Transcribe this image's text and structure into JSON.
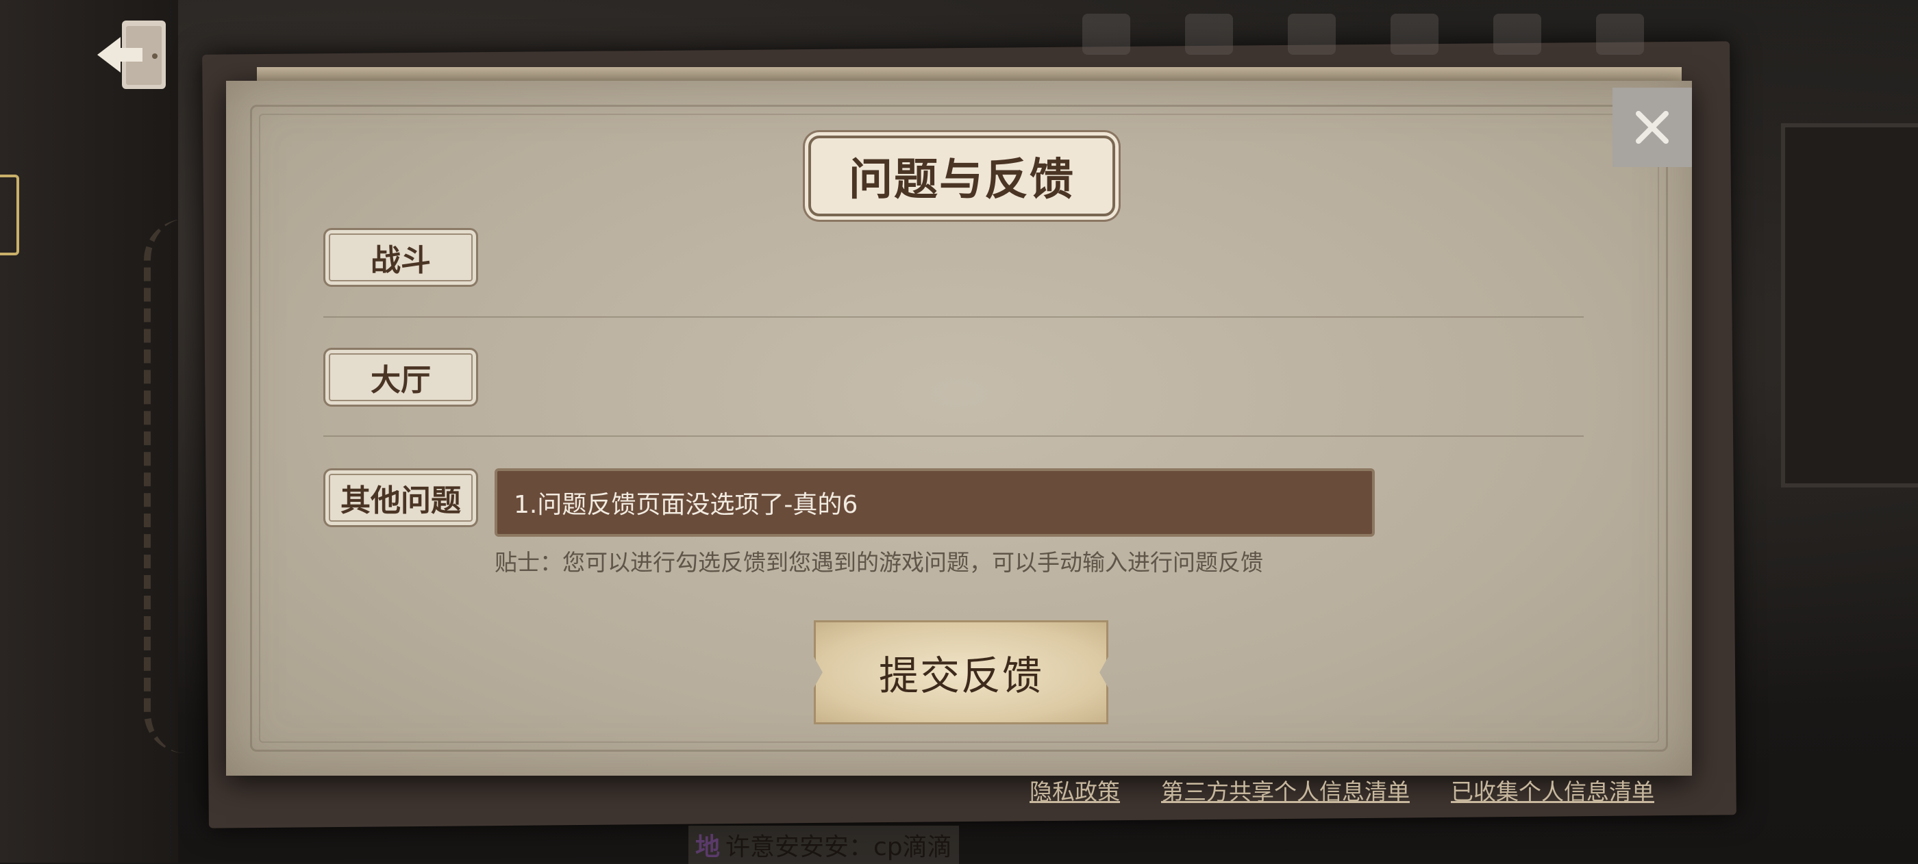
{
  "panel": {
    "title": "问题与反馈",
    "categories": [
      {
        "label": "战斗"
      },
      {
        "label": "大厅"
      },
      {
        "label": "其他问题"
      }
    ],
    "other_input_value": "1.问题反馈页面没选项了-真的6",
    "tip": "贴士：您可以进行勾选反馈到您遇到的游戏问题，可以手动输入进行问题反馈",
    "submit_label": "提交反馈"
  },
  "footer": {
    "links": [
      {
        "label": "隐私政策"
      },
      {
        "label": "第三方共享个人信息清单"
      },
      {
        "label": "已收集个人信息清单"
      }
    ]
  },
  "chat": {
    "prefix": "地",
    "message": "许意安安安：cp滴滴"
  },
  "icons": {
    "back": "exit-door-icon",
    "close": "close-icon"
  },
  "colors": {
    "paper": "#bdb3a2",
    "input_bg": "#6a4c3b",
    "title_text": "#4a3424",
    "link": "#c7b89e"
  }
}
